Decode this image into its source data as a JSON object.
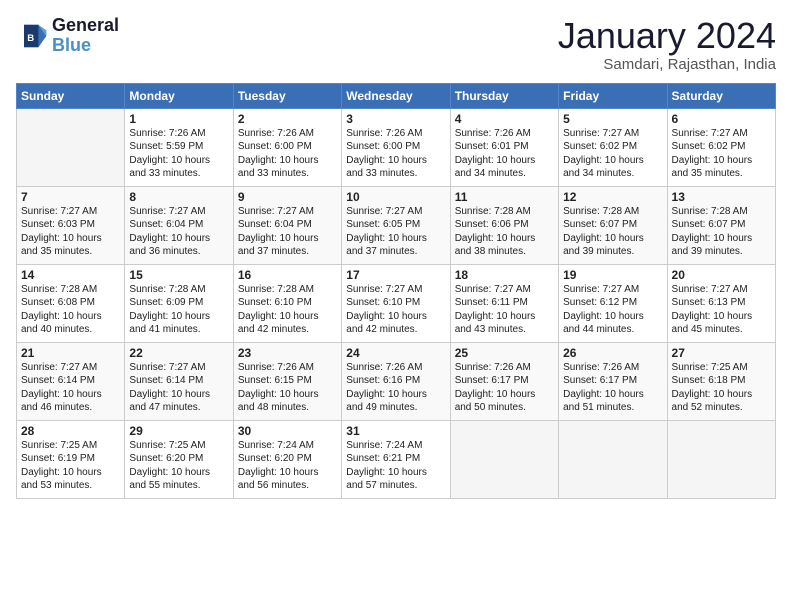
{
  "logo": {
    "line1": "General",
    "line2": "Blue"
  },
  "title": "January 2024",
  "subtitle": "Samdari, Rajasthan, India",
  "days_of_week": [
    "Sunday",
    "Monday",
    "Tuesday",
    "Wednesday",
    "Thursday",
    "Friday",
    "Saturday"
  ],
  "weeks": [
    [
      {
        "day": "",
        "content": ""
      },
      {
        "day": "1",
        "content": "Sunrise: 7:26 AM\nSunset: 5:59 PM\nDaylight: 10 hours\nand 33 minutes."
      },
      {
        "day": "2",
        "content": "Sunrise: 7:26 AM\nSunset: 6:00 PM\nDaylight: 10 hours\nand 33 minutes."
      },
      {
        "day": "3",
        "content": "Sunrise: 7:26 AM\nSunset: 6:00 PM\nDaylight: 10 hours\nand 33 minutes."
      },
      {
        "day": "4",
        "content": "Sunrise: 7:26 AM\nSunset: 6:01 PM\nDaylight: 10 hours\nand 34 minutes."
      },
      {
        "day": "5",
        "content": "Sunrise: 7:27 AM\nSunset: 6:02 PM\nDaylight: 10 hours\nand 34 minutes."
      },
      {
        "day": "6",
        "content": "Sunrise: 7:27 AM\nSunset: 6:02 PM\nDaylight: 10 hours\nand 35 minutes."
      }
    ],
    [
      {
        "day": "7",
        "content": "Sunrise: 7:27 AM\nSunset: 6:03 PM\nDaylight: 10 hours\nand 35 minutes."
      },
      {
        "day": "8",
        "content": "Sunrise: 7:27 AM\nSunset: 6:04 PM\nDaylight: 10 hours\nand 36 minutes."
      },
      {
        "day": "9",
        "content": "Sunrise: 7:27 AM\nSunset: 6:04 PM\nDaylight: 10 hours\nand 37 minutes."
      },
      {
        "day": "10",
        "content": "Sunrise: 7:27 AM\nSunset: 6:05 PM\nDaylight: 10 hours\nand 37 minutes."
      },
      {
        "day": "11",
        "content": "Sunrise: 7:28 AM\nSunset: 6:06 PM\nDaylight: 10 hours\nand 38 minutes."
      },
      {
        "day": "12",
        "content": "Sunrise: 7:28 AM\nSunset: 6:07 PM\nDaylight: 10 hours\nand 39 minutes."
      },
      {
        "day": "13",
        "content": "Sunrise: 7:28 AM\nSunset: 6:07 PM\nDaylight: 10 hours\nand 39 minutes."
      }
    ],
    [
      {
        "day": "14",
        "content": "Sunrise: 7:28 AM\nSunset: 6:08 PM\nDaylight: 10 hours\nand 40 minutes."
      },
      {
        "day": "15",
        "content": "Sunrise: 7:28 AM\nSunset: 6:09 PM\nDaylight: 10 hours\nand 41 minutes."
      },
      {
        "day": "16",
        "content": "Sunrise: 7:28 AM\nSunset: 6:10 PM\nDaylight: 10 hours\nand 42 minutes."
      },
      {
        "day": "17",
        "content": "Sunrise: 7:27 AM\nSunset: 6:10 PM\nDaylight: 10 hours\nand 42 minutes."
      },
      {
        "day": "18",
        "content": "Sunrise: 7:27 AM\nSunset: 6:11 PM\nDaylight: 10 hours\nand 43 minutes."
      },
      {
        "day": "19",
        "content": "Sunrise: 7:27 AM\nSunset: 6:12 PM\nDaylight: 10 hours\nand 44 minutes."
      },
      {
        "day": "20",
        "content": "Sunrise: 7:27 AM\nSunset: 6:13 PM\nDaylight: 10 hours\nand 45 minutes."
      }
    ],
    [
      {
        "day": "21",
        "content": "Sunrise: 7:27 AM\nSunset: 6:14 PM\nDaylight: 10 hours\nand 46 minutes."
      },
      {
        "day": "22",
        "content": "Sunrise: 7:27 AM\nSunset: 6:14 PM\nDaylight: 10 hours\nand 47 minutes."
      },
      {
        "day": "23",
        "content": "Sunrise: 7:26 AM\nSunset: 6:15 PM\nDaylight: 10 hours\nand 48 minutes."
      },
      {
        "day": "24",
        "content": "Sunrise: 7:26 AM\nSunset: 6:16 PM\nDaylight: 10 hours\nand 49 minutes."
      },
      {
        "day": "25",
        "content": "Sunrise: 7:26 AM\nSunset: 6:17 PM\nDaylight: 10 hours\nand 50 minutes."
      },
      {
        "day": "26",
        "content": "Sunrise: 7:26 AM\nSunset: 6:17 PM\nDaylight: 10 hours\nand 51 minutes."
      },
      {
        "day": "27",
        "content": "Sunrise: 7:25 AM\nSunset: 6:18 PM\nDaylight: 10 hours\nand 52 minutes."
      }
    ],
    [
      {
        "day": "28",
        "content": "Sunrise: 7:25 AM\nSunset: 6:19 PM\nDaylight: 10 hours\nand 53 minutes."
      },
      {
        "day": "29",
        "content": "Sunrise: 7:25 AM\nSunset: 6:20 PM\nDaylight: 10 hours\nand 55 minutes."
      },
      {
        "day": "30",
        "content": "Sunrise: 7:24 AM\nSunset: 6:20 PM\nDaylight: 10 hours\nand 56 minutes."
      },
      {
        "day": "31",
        "content": "Sunrise: 7:24 AM\nSunset: 6:21 PM\nDaylight: 10 hours\nand 57 minutes."
      },
      {
        "day": "",
        "content": ""
      },
      {
        "day": "",
        "content": ""
      },
      {
        "day": "",
        "content": ""
      }
    ]
  ]
}
